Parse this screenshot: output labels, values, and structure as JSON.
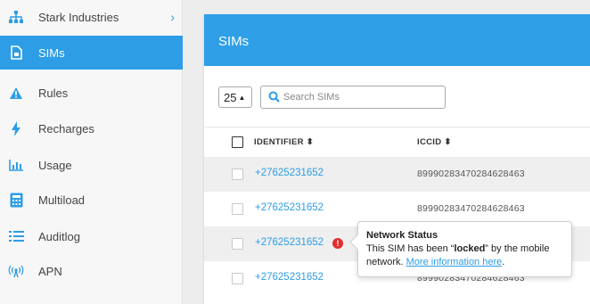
{
  "sidebar": {
    "org": {
      "label": "Stark Industries",
      "icon": "org-chart-icon"
    },
    "items": [
      {
        "label": "SIMs",
        "icon": "sim-card-icon",
        "active": true
      },
      {
        "label": "Rules",
        "icon": "warning-icon"
      },
      {
        "label": "Recharges",
        "icon": "lightning-icon"
      },
      {
        "label": "Usage",
        "icon": "bar-chart-icon"
      },
      {
        "label": "Multiload",
        "icon": "calculator-icon"
      },
      {
        "label": "Auditlog",
        "icon": "list-icon"
      },
      {
        "label": "APN",
        "icon": "antenna-icon"
      }
    ]
  },
  "main": {
    "title": "SIMs",
    "page_size": "25",
    "search_placeholder": "Search SIMs",
    "columns": {
      "identifier": "IDENTIFIER",
      "iccid": "ICCID"
    },
    "rows": [
      {
        "identifier": "+27625231652",
        "iccid": "89990283470284628463",
        "error": false
      },
      {
        "identifier": "+27625231652",
        "iccid": "89990283470284628463",
        "error": false
      },
      {
        "identifier": "+27625231652",
        "iccid": "",
        "error": true
      },
      {
        "identifier": "+27625231652",
        "iccid": "89990283470284628463",
        "error": false
      }
    ]
  },
  "tooltip": {
    "title": "Network Status",
    "text_before": "This SIM has been “",
    "status": "locked",
    "text_after": "” by the mobile network. ",
    "link": "More information here",
    "link_suffix": "."
  },
  "colors": {
    "accent": "#2d9de6",
    "header": "#2f9fe7",
    "error": "#e12e2e"
  }
}
